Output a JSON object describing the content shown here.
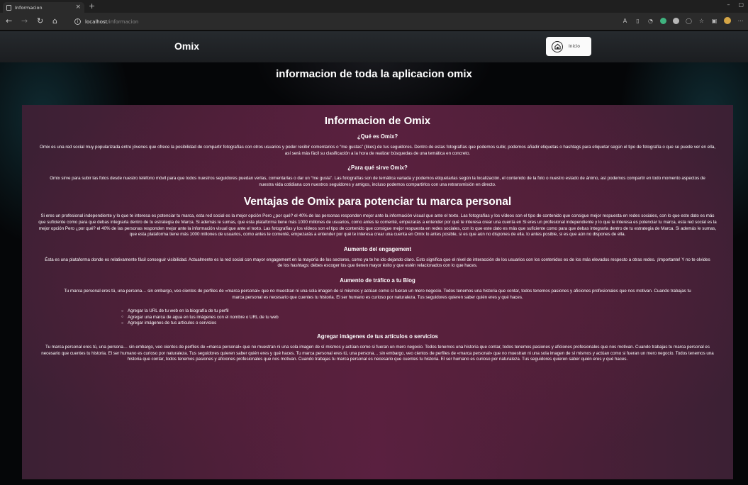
{
  "browser": {
    "tab_title": "Informacion",
    "tab_close": "×",
    "new_tab": "+",
    "url_host": "localhost",
    "url_path": "/informacion",
    "info_glyph": "i",
    "window_controls": [
      "–",
      "▢"
    ],
    "icons": [
      "back-icon",
      "forward-icon",
      "reload-icon",
      "home-icon",
      "info-icon",
      "read-aloud-icon",
      "reader-mode-icon",
      "tracking-icon",
      "extension-icon",
      "favorites-icon",
      "collections-icon",
      "profile-icon"
    ]
  },
  "site": {
    "brand": "Omix",
    "nav_button_label": "Inicio",
    "main_title": "informacion de toda la aplicacion omix"
  },
  "content": {
    "h_info": "Informacion de Omix",
    "q_what": "¿Qué es Omix?",
    "p_what": "Omix es una red social muy popularizada entre jóvenes que ofrece la posibilidad de compartir fotografías con otros usuarios y poder recibir comentarios o “me gustas” (likes) de tus seguidores. Dentro de estas fotografías que podemos subir, podemos añadir etiquetas o hashtags para etiquetar según el tipo de fotografía o que se puede ver en ella, así será más fácil su clasificación a la hora de realizar búsquedas de una temática en concreto.",
    "q_for": "¿Para qué sirve Omix?",
    "p_for": "Omix sirve para subir las fotos desde nuestro teléfono móvil para que todos nuestros seguidores puedan verlas, comentarlas o dar un “me gusta”. Las fotografías son de temática variada y podemos etiquetarlas según la localización, el contenido de la foto o nuestro estado de ánimo, así podemos compartir en todo momento aspectos de nuestra vida cotidiana con nuestros seguidores y amigos, incluso podemos compartirlos con una retransmisión en directo.",
    "h_ventajas": "Ventajas de Omix para potenciar tu marca personal",
    "p_ventajas": "Si eres un profesional independiente y lo que te interesa es potenciar tu marca, esta red social es la mejor opción Pero ¿por qué? el 40% de las personas responden mejor ante la información visual que ante el texto. Las fotografías y los vídeos son el tipo de contenido que consigue mejor respuesta en redes sociales, con lo que este dato es más que suficiente como para que debas integrarla dentro de tu estrategia de Marca. Si además le sumas, que esta plataforma tiene más 1000 millones de usuarios, como antes te comenté, empezarás a entender por qué te interesa crear una cuenta en Si eres un profesional independiente y lo que te interesa es potenciar tu marca, esta red social es la mejor opción Pero ¿por qué? el 40% de las personas responden mejor ante la información visual que ante el texto. Las fotografías y los vídeos son el tipo de contenido que consigue mejor respuesta en redes sociales, con lo que este dato es más que suficiente como para que debas integrarla dentro de tu estrategia de Marca. Si además le sumas, que esta plataforma tiene más 1000 millones de usuarios, como antes te comenté, empezarás a entender por qué te interesa crear una cuenta en Omix lo antes posible, si es que aún no dispones de ella. lo antes posible, si es que aún no dispones de ella.",
    "h_engagement": "Aumento del engagement",
    "p_engagement": "Ésta es una plataforma donde es relativamente fácil conseguir visibilidad. Actualmente es la red social con mayor engagement en la mayoría de los sectores, como ya te he ido dejando claro. Esto significa que el nivel de interacción de los usuarios con los contenidos es de los más elevados respecto a otras redes. ¡Importante! Y no te olvides de los hashtags: debes escoger los que tienen mayor éxito y que estén relacionados con lo que haces.",
    "h_blog": "Aumento de tráfico a tu Blog",
    "p_blog": "Tu marca personal eres tú, una persona… sin embargo, veo cientos de perfiles de «marca personal» que no muestran ni una sola imagen de sí mismos y actúan como si fueran un mero negocio. Todos tenemos una historia que contar, todos tenemos pasiones y aficiones profesionales que nos motivan. Cuando trabajas tu marca personal es necesario que cuentes tu historia. El ser humano es curioso por naturaleza. Tus seguidores quieren saber quién eres y qué haces.",
    "list": [
      "Agregar la URL de tu web en la biografía de tu perfil",
      "Agregar una marca de agua en tus imágenes con el nombre o URL de tu web",
      "Agregar imágenes de tus artículos o servicios"
    ],
    "h_imagenes": "Agregar imágenes de tus artículos o servicios",
    "p_imagenes": "Tu marca personal eres tú, una persona… sin embargo, veo cientos de perfiles de «marca personal» que no muestran ni una sola imagen de sí mismos y actúan como si fueran un mero negocio. Todos tenemos una historia que contar, todos tenemos pasiones y aficiones profesionales que nos motivan. Cuando trabajas tu marca personal es necesario que cuentes tu historia. El ser humano es curioso por naturaleza. Tus seguidores quieren saber quién eres y qué haces. Tu marca personal eres tú, una persona… sin embargo, veo cientos de perfiles de «marca personal» que no muestran ni una sola imagen de sí mismos y actúan como si fueran un mero negocio. Todos tenemos una historia que contar, todos tenemos pasiones y aficiones profesionales que nos motivan. Cuando trabajas tu marca personal es necesario que cuentes tu historia. El ser humano es curioso por naturaleza. Tus seguidores quieren saber quién eres y qué haces."
  }
}
